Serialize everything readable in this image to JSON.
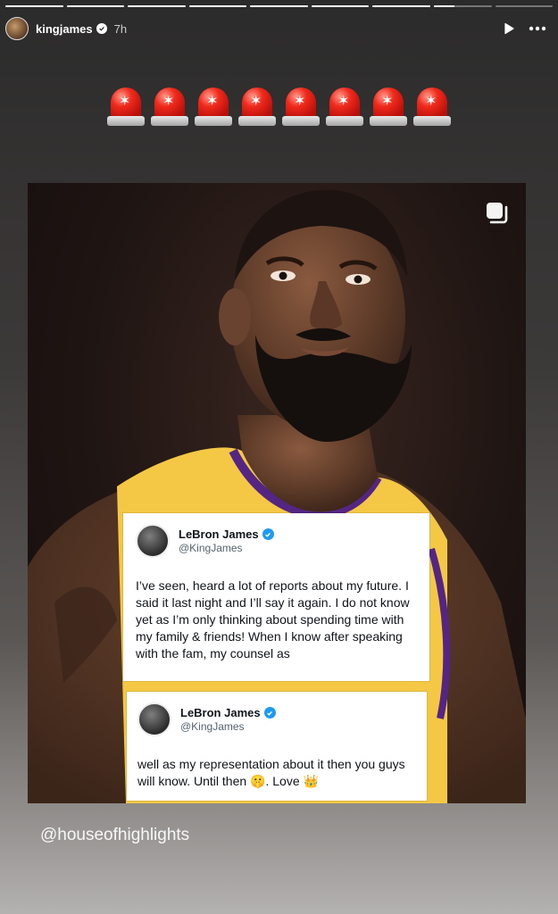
{
  "progress": {
    "segments": [
      1,
      1,
      1,
      1,
      1,
      1,
      1,
      0.35,
      0
    ],
    "active_index": 7
  },
  "header": {
    "username": "kingjames",
    "time": "7h",
    "verified": true,
    "play_icon": "play-icon",
    "more_icon": "more-icon"
  },
  "stickers": {
    "emoji": "🚨",
    "count": 8,
    "icon": "police-siren-icon"
  },
  "post": {
    "multi_icon": "multiple-images-icon",
    "tweet1": {
      "name": "LeBron James",
      "handle": "@KingJames",
      "text": "I’ve seen, heard a lot of reports about my future. I said it last night and I’ll say it again. I do not know yet as I’m only thinking about spending time with my family & friends! When I know after speaking with the fam, my counsel as"
    },
    "tweet2": {
      "name": "LeBron James",
      "handle": "@KingJames",
      "text": "well as my representation about it then you guys will know. Until then 🤫. Love 👑"
    }
  },
  "mention": "@houseofhighlights",
  "colors": {
    "twitter_blue": "#1d9bf0",
    "jersey_gold": "#f4c744",
    "jersey_purple": "#552583"
  }
}
